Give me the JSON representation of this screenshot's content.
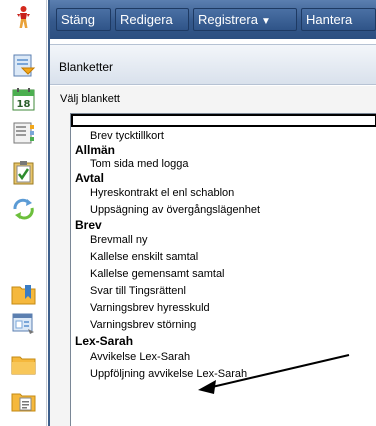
{
  "toolbar": {
    "close_label": "Stäng",
    "edit_label": "Redigera",
    "register_label": "Registrera",
    "manage_label": "Hantera",
    "register_caret": "▼"
  },
  "panel": {
    "title": "Blanketter",
    "select_label": "Välj blankett"
  },
  "list": {
    "selected": "",
    "ungrouped": [
      "Brev tycktillkort"
    ],
    "groups": [
      {
        "name": "Allmän",
        "items": [
          "Tom sida med logga"
        ]
      },
      {
        "name": "Avtal",
        "items": [
          "Hyreskontrakt el enl schablon",
          "Uppsägning av övergångslägenhet"
        ]
      },
      {
        "name": "Brev",
        "items": [
          "Brevmall ny",
          "Kallelse enskilt samtal",
          "Kallelse gemensamt samtal",
          "Svar till Tingsrättenl",
          "Varningsbrev hyresskuld",
          "Varningsbrev störning"
        ]
      },
      {
        "name": "Lex-Sarah",
        "items": [
          "Avvikelse Lex-Sarah",
          "Uppföljning avvikelse Lex-Sarah"
        ]
      }
    ]
  },
  "icons": {
    "rail": [
      "person-icon",
      "form-icon",
      "calendar-icon",
      "contacts-icon",
      "checklist-icon",
      "refresh-icon",
      "folder-bookmark-icon",
      "window-icon",
      "folder-icon",
      "folder-document-icon"
    ],
    "calendar_day": "18"
  },
  "colors": {
    "toolbar": "#35598c",
    "panel_header": "#dfe6ef",
    "content_bg": "#f4f4f4"
  }
}
